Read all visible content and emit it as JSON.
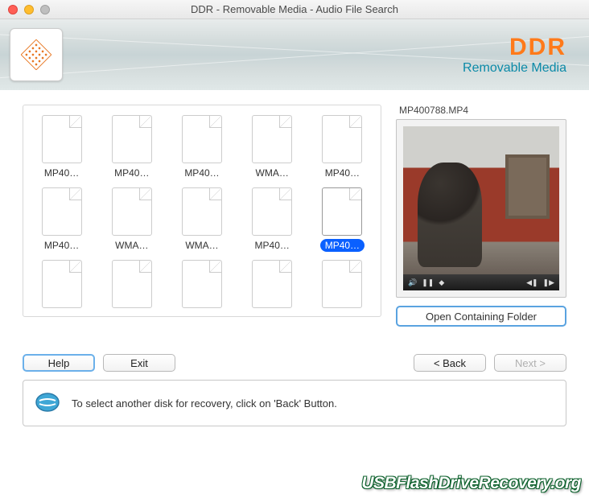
{
  "window": {
    "title": "DDR - Removable Media - Audio File Search"
  },
  "brand": {
    "title": "DDR",
    "subtitle": "Removable Media"
  },
  "files": [
    {
      "label": "MP40…",
      "selected": false
    },
    {
      "label": "MP40…",
      "selected": false
    },
    {
      "label": "MP40…",
      "selected": false
    },
    {
      "label": "WMA…",
      "selected": false
    },
    {
      "label": "MP40…",
      "selected": false
    },
    {
      "label": "MP40…",
      "selected": false
    },
    {
      "label": "WMA…",
      "selected": false
    },
    {
      "label": "WMA…",
      "selected": false
    },
    {
      "label": "MP40…",
      "selected": false
    },
    {
      "label": "MP40…",
      "selected": true
    },
    {
      "label": "",
      "selected": false
    },
    {
      "label": "",
      "selected": false
    },
    {
      "label": "",
      "selected": false
    },
    {
      "label": "",
      "selected": false
    },
    {
      "label": "",
      "selected": false
    }
  ],
  "preview": {
    "filename": "MP400788.MP4",
    "open_folder_label": "Open Containing Folder"
  },
  "buttons": {
    "help": "Help",
    "exit": "Exit",
    "back": "< Back",
    "next": "Next >"
  },
  "hint": {
    "text": "To select another disk for recovery, click on 'Back' Button."
  },
  "watermark": "USBFlashDriveRecovery.org"
}
